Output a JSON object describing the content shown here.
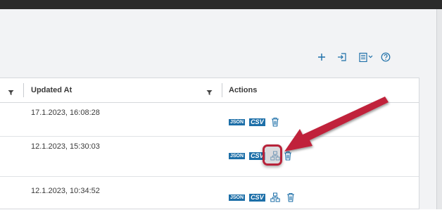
{
  "table": {
    "columns": [
      {
        "label": ""
      },
      {
        "label": "Updated At"
      },
      {
        "label": "Actions"
      }
    ],
    "rows": [
      {
        "updated_at": "17.1.2023, 16:08:28",
        "actions": [
          "json-icon",
          "csv-icon",
          "trash-icon"
        ]
      },
      {
        "updated_at": "12.1.2023, 15:30:03",
        "actions": [
          "json-icon",
          "csv-icon",
          "hierarchy-icon",
          "trash-icon"
        ]
      },
      {
        "updated_at": "12.1.2023, 10:34:52",
        "actions": [
          "json-icon",
          "csv-icon",
          "hierarchy-icon",
          "trash-icon"
        ]
      }
    ]
  },
  "badges": {
    "json": "JSON",
    "csv": "CSV"
  },
  "toolbar": {
    "icons": [
      "plus-icon",
      "import-icon",
      "document-dropdown-icon",
      "help-icon"
    ]
  },
  "colors": {
    "accent": "#1d6fa8",
    "annotation": "#b8233a",
    "topbar": "#2b2b2b"
  }
}
